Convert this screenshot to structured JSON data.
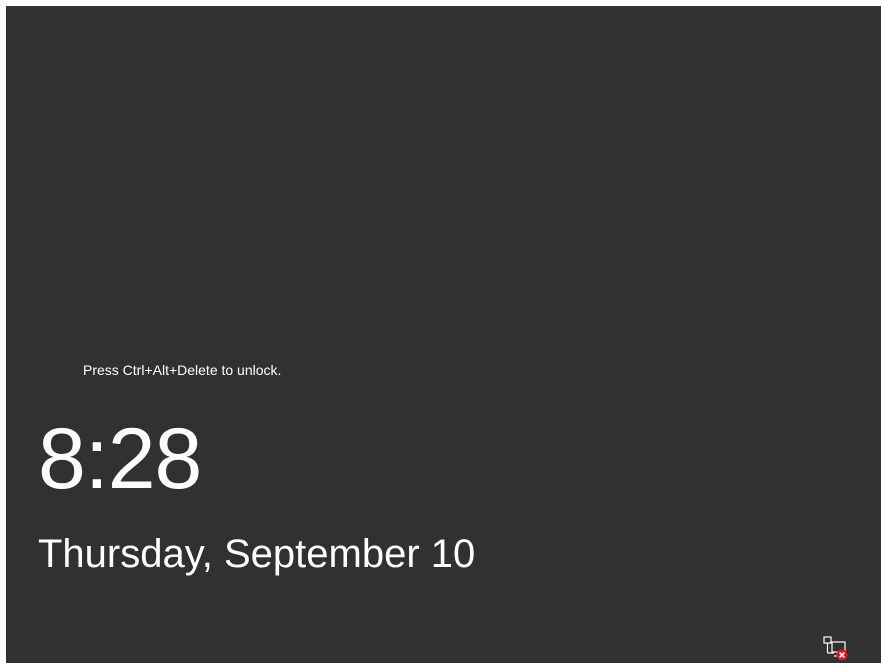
{
  "lock_screen": {
    "unlock_hint": "Press Ctrl+Alt+Delete to unlock.",
    "time": "8:28",
    "date": "Thursday, September 10",
    "background_color": "#313131",
    "text_color": "#ffffff"
  },
  "status_icons": {
    "network": {
      "icon": "network-disconnected-icon",
      "status_color": "#e81123"
    }
  }
}
